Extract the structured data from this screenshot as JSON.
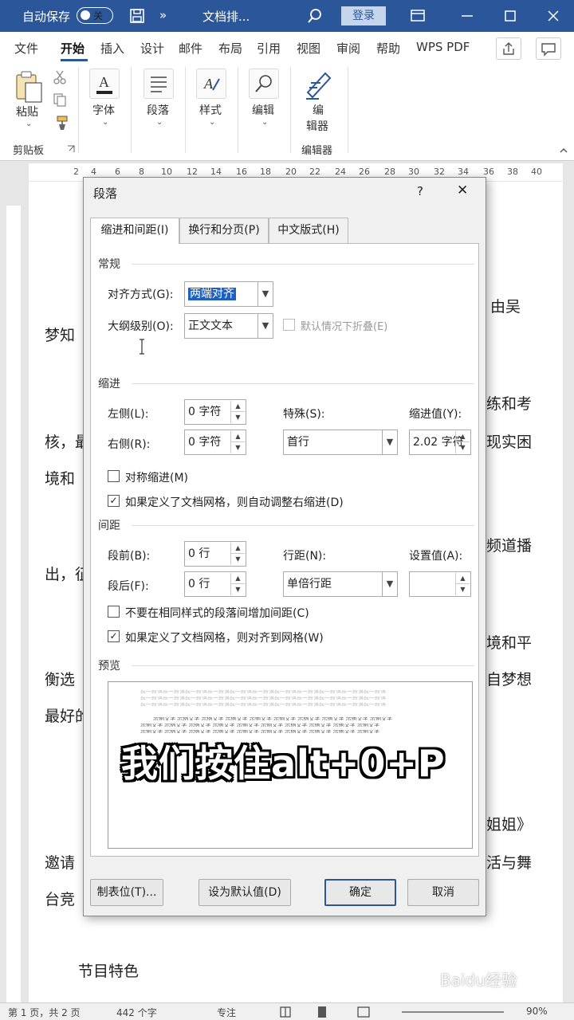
{
  "titlebar": {
    "autosave_label": "自动保存",
    "autosave_state": "关",
    "more": "»",
    "doc_title": "文档排...",
    "login": "登录"
  },
  "menu": {
    "items": [
      "文件",
      "开始",
      "插入",
      "设计",
      "邮件",
      "布局",
      "引用",
      "视图",
      "审阅",
      "帮助",
      "WPS PDF"
    ],
    "active": "开始"
  },
  "ribbon": {
    "paste": "粘贴",
    "clipboard_group": "剪贴板",
    "font": "字体",
    "paragraph": "段落",
    "styles": "样式",
    "editing": "编辑",
    "editor_line1": "编",
    "editor_line2": "辑器",
    "editor_group": "编辑器"
  },
  "ruler": {
    "ticks": [
      "2",
      "4",
      "6",
      "8",
      "10",
      "12",
      "14",
      "16",
      "18",
      "20",
      "22",
      "24",
      "26",
      "28",
      "30",
      "32",
      "34",
      "36",
      "38",
      "40"
    ]
  },
  "document": {
    "lines": [
      {
        "text": "，由吴"
      },
      {
        "text": "梦知"
      },
      {
        "text": "练和考"
      },
      {
        "text": "核，最"
      },
      {
        "text": "现实困"
      },
      {
        "text": "境和"
      },
      {
        "text": "频道播"
      },
      {
        "text": "出，征"
      },
      {
        "text": "境和平"
      },
      {
        "text": "衡选"
      },
      {
        "text": "自梦想"
      },
      {
        "text": "最好的"
      },
      {
        "text": "姐姐》"
      },
      {
        "text": "邀请"
      },
      {
        "text": "活与舞"
      },
      {
        "text": "台竞"
      },
      {
        "text": "节目特色"
      }
    ]
  },
  "status": {
    "page": "第 1 页，共 2 页",
    "words": "442 个字",
    "focus": "专注",
    "zoom": "90%"
  },
  "dialog": {
    "title": "段落",
    "help": "?",
    "close": "✕",
    "tabs": [
      "缩进和间距(I)",
      "换行和分页(P)",
      "中文版式(H)"
    ],
    "general": {
      "section": "常规",
      "alignment_label": "对齐方式(G):",
      "alignment_value": "两端对齐",
      "outline_label": "大纲级别(O):",
      "outline_value": "正文文本",
      "collapse_label": "默认情况下折叠(E)"
    },
    "indent": {
      "section": "缩进",
      "left_label": "左侧(L):",
      "left_value": "0 字符",
      "right_label": "右侧(R):",
      "right_value": "0 字符",
      "special_label": "特殊(S):",
      "special_value": "首行",
      "by_label": "缩进值(Y):",
      "by_value": "2.02 字符",
      "mirror_label": "对称缩进(M)",
      "mirror_checked": false,
      "auto_adjust_label": "如果定义了文档网格，则自动调整右缩进(D)",
      "auto_adjust_checked": true
    },
    "spacing": {
      "section": "间距",
      "before_label": "段前(B):",
      "before_value": "0 行",
      "after_label": "段后(F):",
      "after_value": "0 行",
      "line_label": "行距(N):",
      "line_value": "单倍行距",
      "at_label": "设置值(A):",
      "at_value": "",
      "no_space_label": "不要在相同样式的段落间增加间距(C)",
      "no_space_checked": false,
      "snap_grid_label": "如果定义了文档网格，则对齐到网格(W)",
      "snap_grid_checked": true
    },
    "preview": {
      "section": "预览",
      "prev_text": "前一段落前一段落前一段落前一段落前一段落前一段落前一段落前一段落前一段落前一段落前一段落",
      "sample_text": "示例文字 示例文字 示例文字 示例文字 示例文字 示例文字 示例文字 示例文字 示例文字 示例文字"
    },
    "overlay_caption": "我们按住alt+0+P",
    "buttons": {
      "tabs": "制表位(T)...",
      "set_default": "设为默认值(D)",
      "ok": "确定",
      "cancel": "取消"
    }
  },
  "watermark": "Baidu经验",
  "colors": {
    "title_bar": "#2b579a",
    "selection": "#1e5fbf"
  }
}
